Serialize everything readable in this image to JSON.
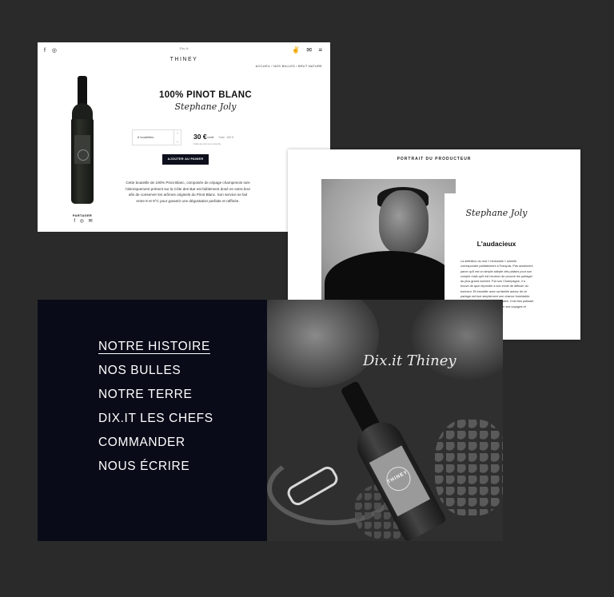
{
  "product_page": {
    "social_icons": [
      "f",
      "◎"
    ],
    "logo_script": "Dix.it",
    "logo_name": "THINEY",
    "action_icons": [
      "✌",
      "✉",
      "≡"
    ],
    "breadcrumb": "ACCUEIL / NOS BULLES / BRUT NATURE",
    "title": "100% PINOT BLANC",
    "producer_signature": "Stephane Joly",
    "quantity_text": "6 bouteilles",
    "stepper_up": "⌃",
    "stepper_down": "⌄",
    "price": "30 €",
    "price_unit": "/unité",
    "price_total": "Total : 180 €",
    "price_note": "Frais de port non compris",
    "add_to_cart_label": "AJOUTER AU PANIER",
    "description": "Cette bouteille de 100% Pinot Blanc, composée de cépage champenois rare historiquement présent sur la Côte des Bar est faiblement dosé en extra brut afin de conserver les arômes originels du Pinot Blanc. Son service se fait entre 8 et 9°C pour garantir une dégustation parfaite et raffinée.",
    "share_label": "PARTAGER",
    "share_icons": [
      "f",
      "◎",
      "✉"
    ]
  },
  "portrait": {
    "header": "PORTRAIT DU PRODUCTEUR",
    "signature": "Stephane Joly",
    "subtitle": "L'audacieux",
    "body": "La définition du mot « hédoniste » semble correspondre parfaitement à François. Pas seulement parce qu'il est un simple adepte des plaisirs pour son compte mais qu'il est heureux de pouvoir les partager au plus grand nombre. Par son Champagne, il a trouvé de quoi répondre à son envie de diffuser du bonheur. Et travailler avec sa famille autour de ce partage est tout simplement une chance formidable. Doté d'un franc parler et visionnaire, il est très plaisant d'écouter François nous raconter ses voyages et expériences à travers les bulles."
  },
  "menu": {
    "items": [
      "NOTRE HISTOIRE",
      "NOS BULLES",
      "NOTRE TERRE",
      "DIX.IT LES CHEFS",
      "COMMANDER",
      "NOUS ÉCRIRE"
    ],
    "active_index": 0
  },
  "photo": {
    "signature": "Dix.it Thiney",
    "bottle_label": "THINEY"
  },
  "colors": {
    "background": "#2a2a2a",
    "navy": "#090b18",
    "button": "#0d0f1c",
    "white": "#ffffff"
  }
}
